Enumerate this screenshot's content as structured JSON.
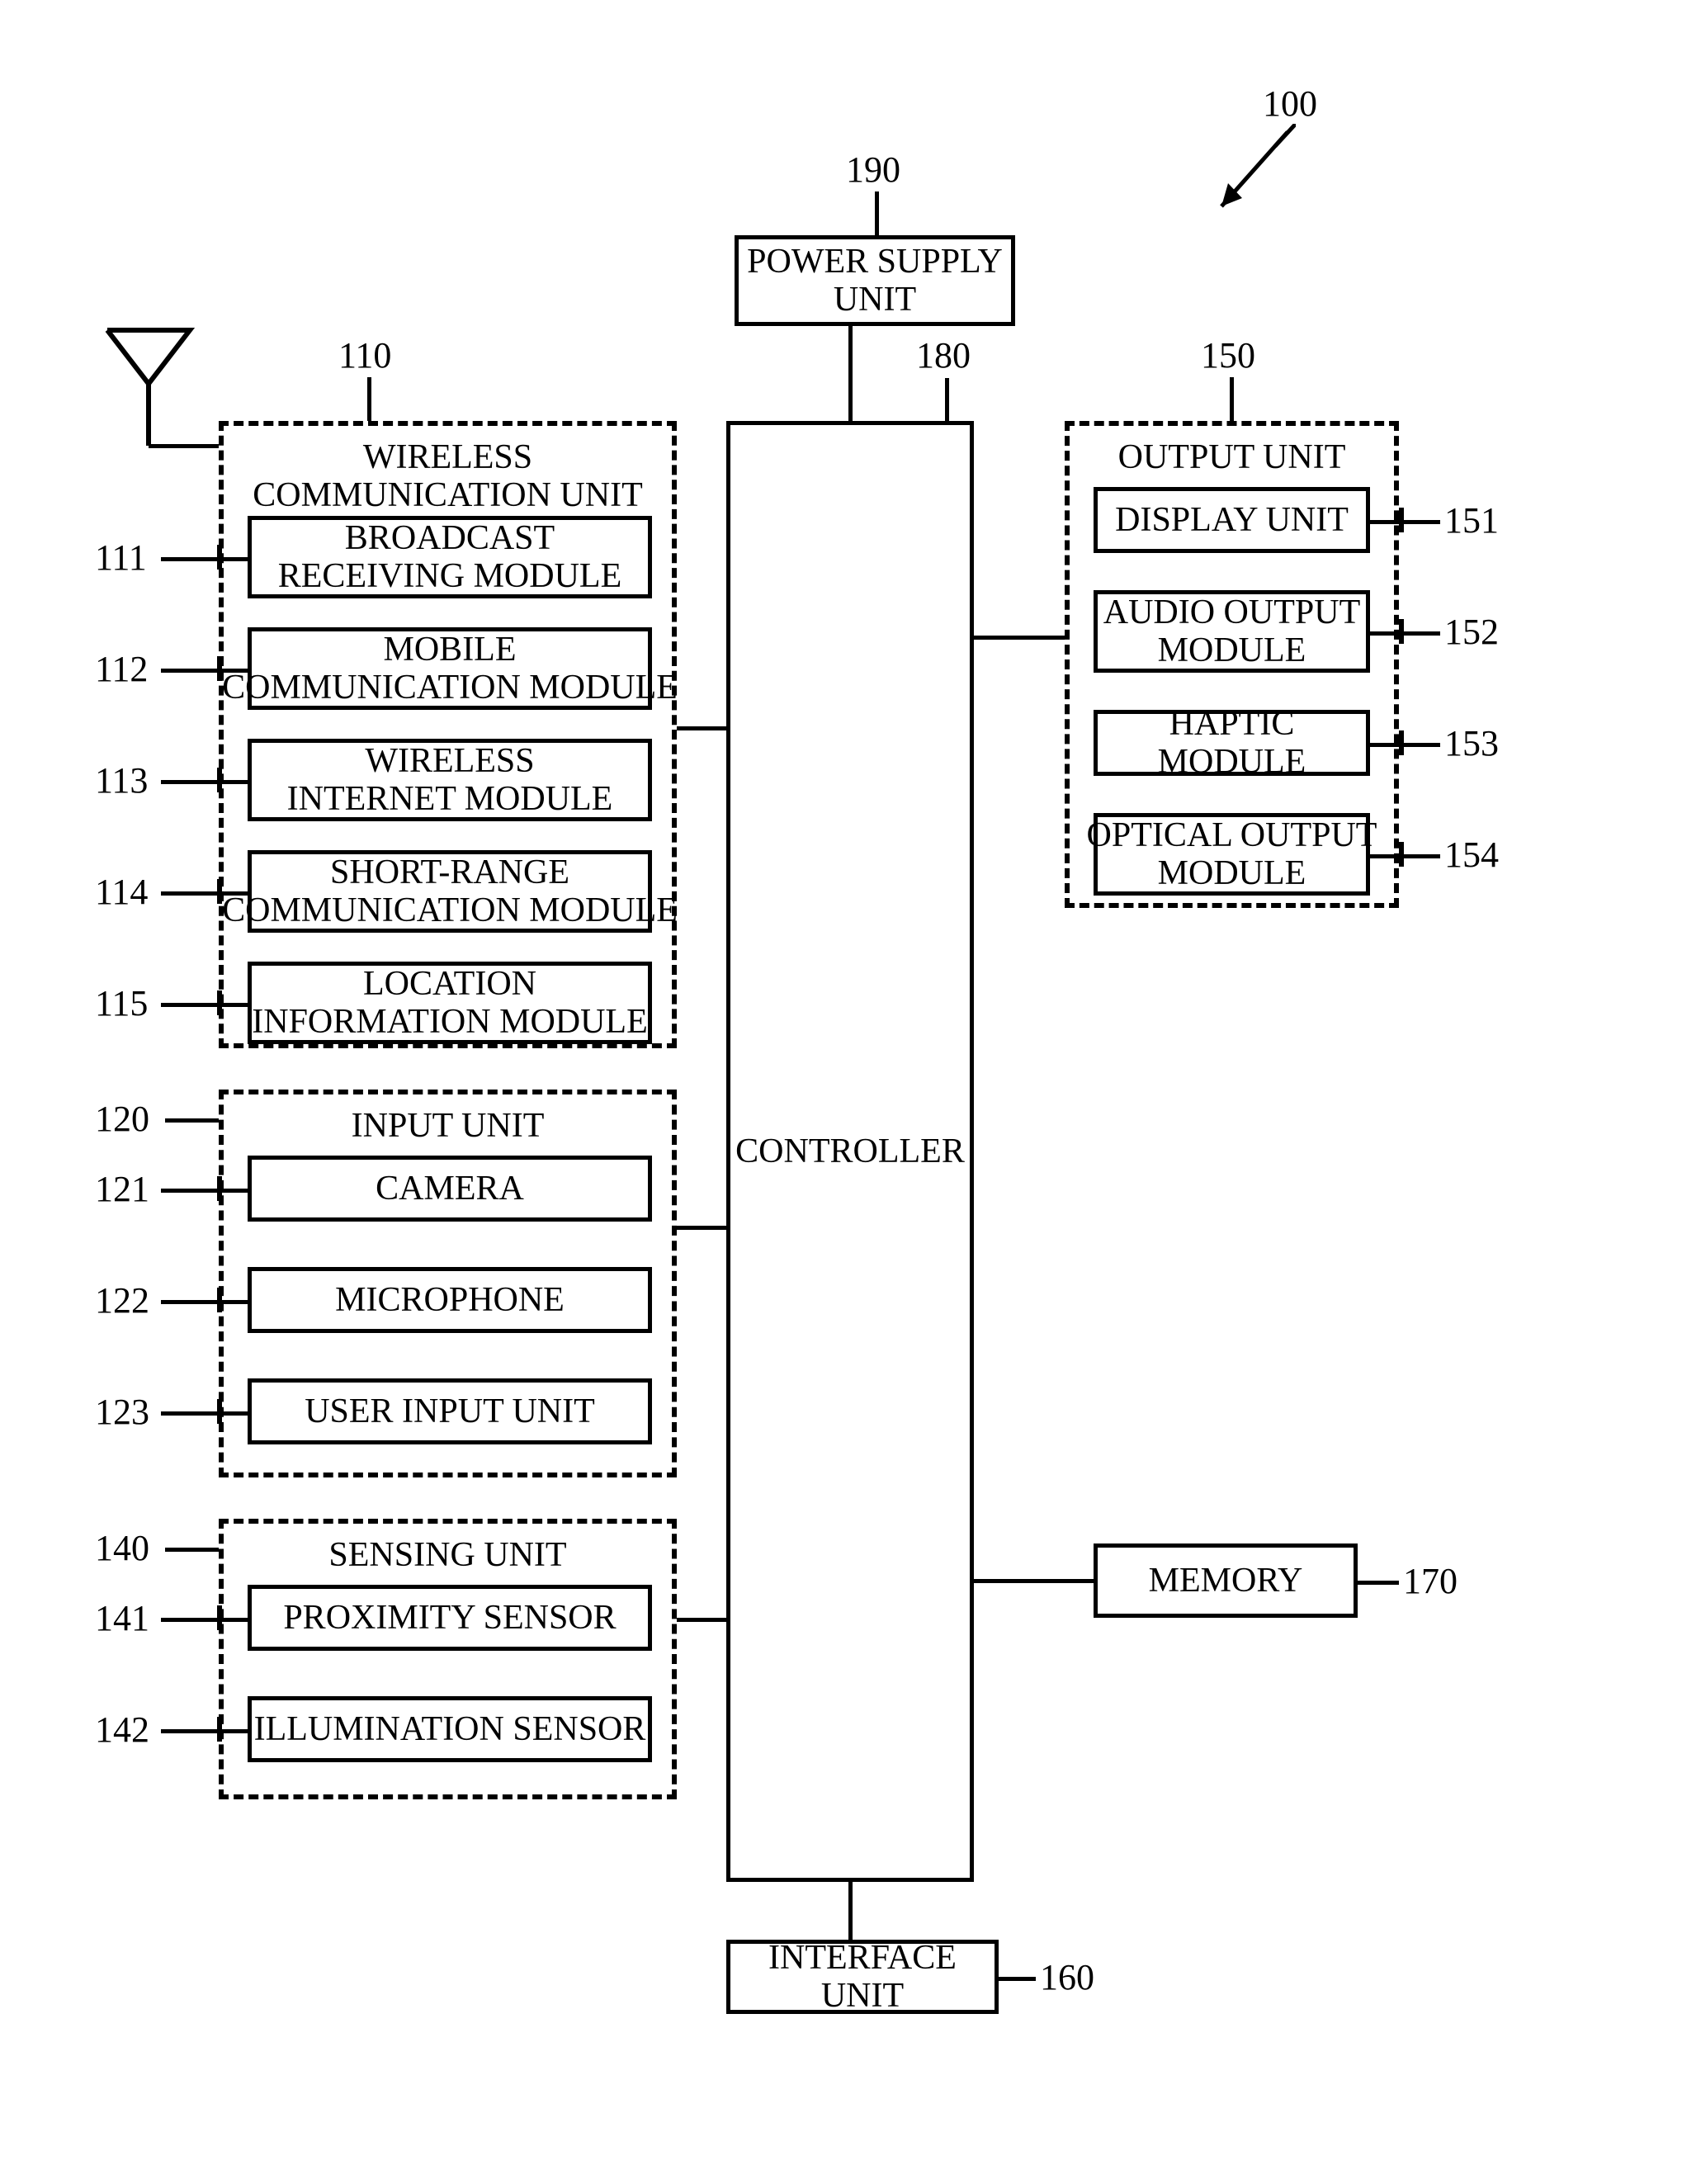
{
  "refs": {
    "r100": "100",
    "r190": "190",
    "r180": "180",
    "r110": "110",
    "r111": "111",
    "r112": "112",
    "r113": "113",
    "r114": "114",
    "r115": "115",
    "r120": "120",
    "r121": "121",
    "r122": "122",
    "r123": "123",
    "r140": "140",
    "r141": "141",
    "r142": "142",
    "r150": "150",
    "r151": "151",
    "r152": "152",
    "r153": "153",
    "r154": "154",
    "r160": "160",
    "r170": "170"
  },
  "blocks": {
    "power_supply": "POWER SUPPLY\nUNIT",
    "controller": "CONTROLLER",
    "interface_unit": "INTERFACE UNIT",
    "memory": "MEMORY",
    "wireless_title": "WIRELESS\nCOMMUNICATION UNIT",
    "broadcast": "BROADCAST\nRECEIVING MODULE",
    "mobile": "MOBILE\nCOMMUNICATION MODULE",
    "winternet": "WIRELESS\nINTERNET MODULE",
    "shortrange": "SHORT-RANGE\nCOMMUNICATION MODULE",
    "location": "LOCATION\nINFORMATION MODULE",
    "input_title": "INPUT UNIT",
    "camera": "CAMERA",
    "microphone": "MICROPHONE",
    "user_input": "USER INPUT UNIT",
    "sensing_title": "SENSING UNIT",
    "proximity": "PROXIMITY SENSOR",
    "illumination": "ILLUMINATION SENSOR",
    "output_title": "OUTPUT UNIT",
    "display": "DISPLAY UNIT",
    "audio": "AUDIO OUTPUT\nMODULE",
    "haptic": "HAPTIC MODULE",
    "optical": "OPTICAL OUTPUT\nMODULE"
  }
}
